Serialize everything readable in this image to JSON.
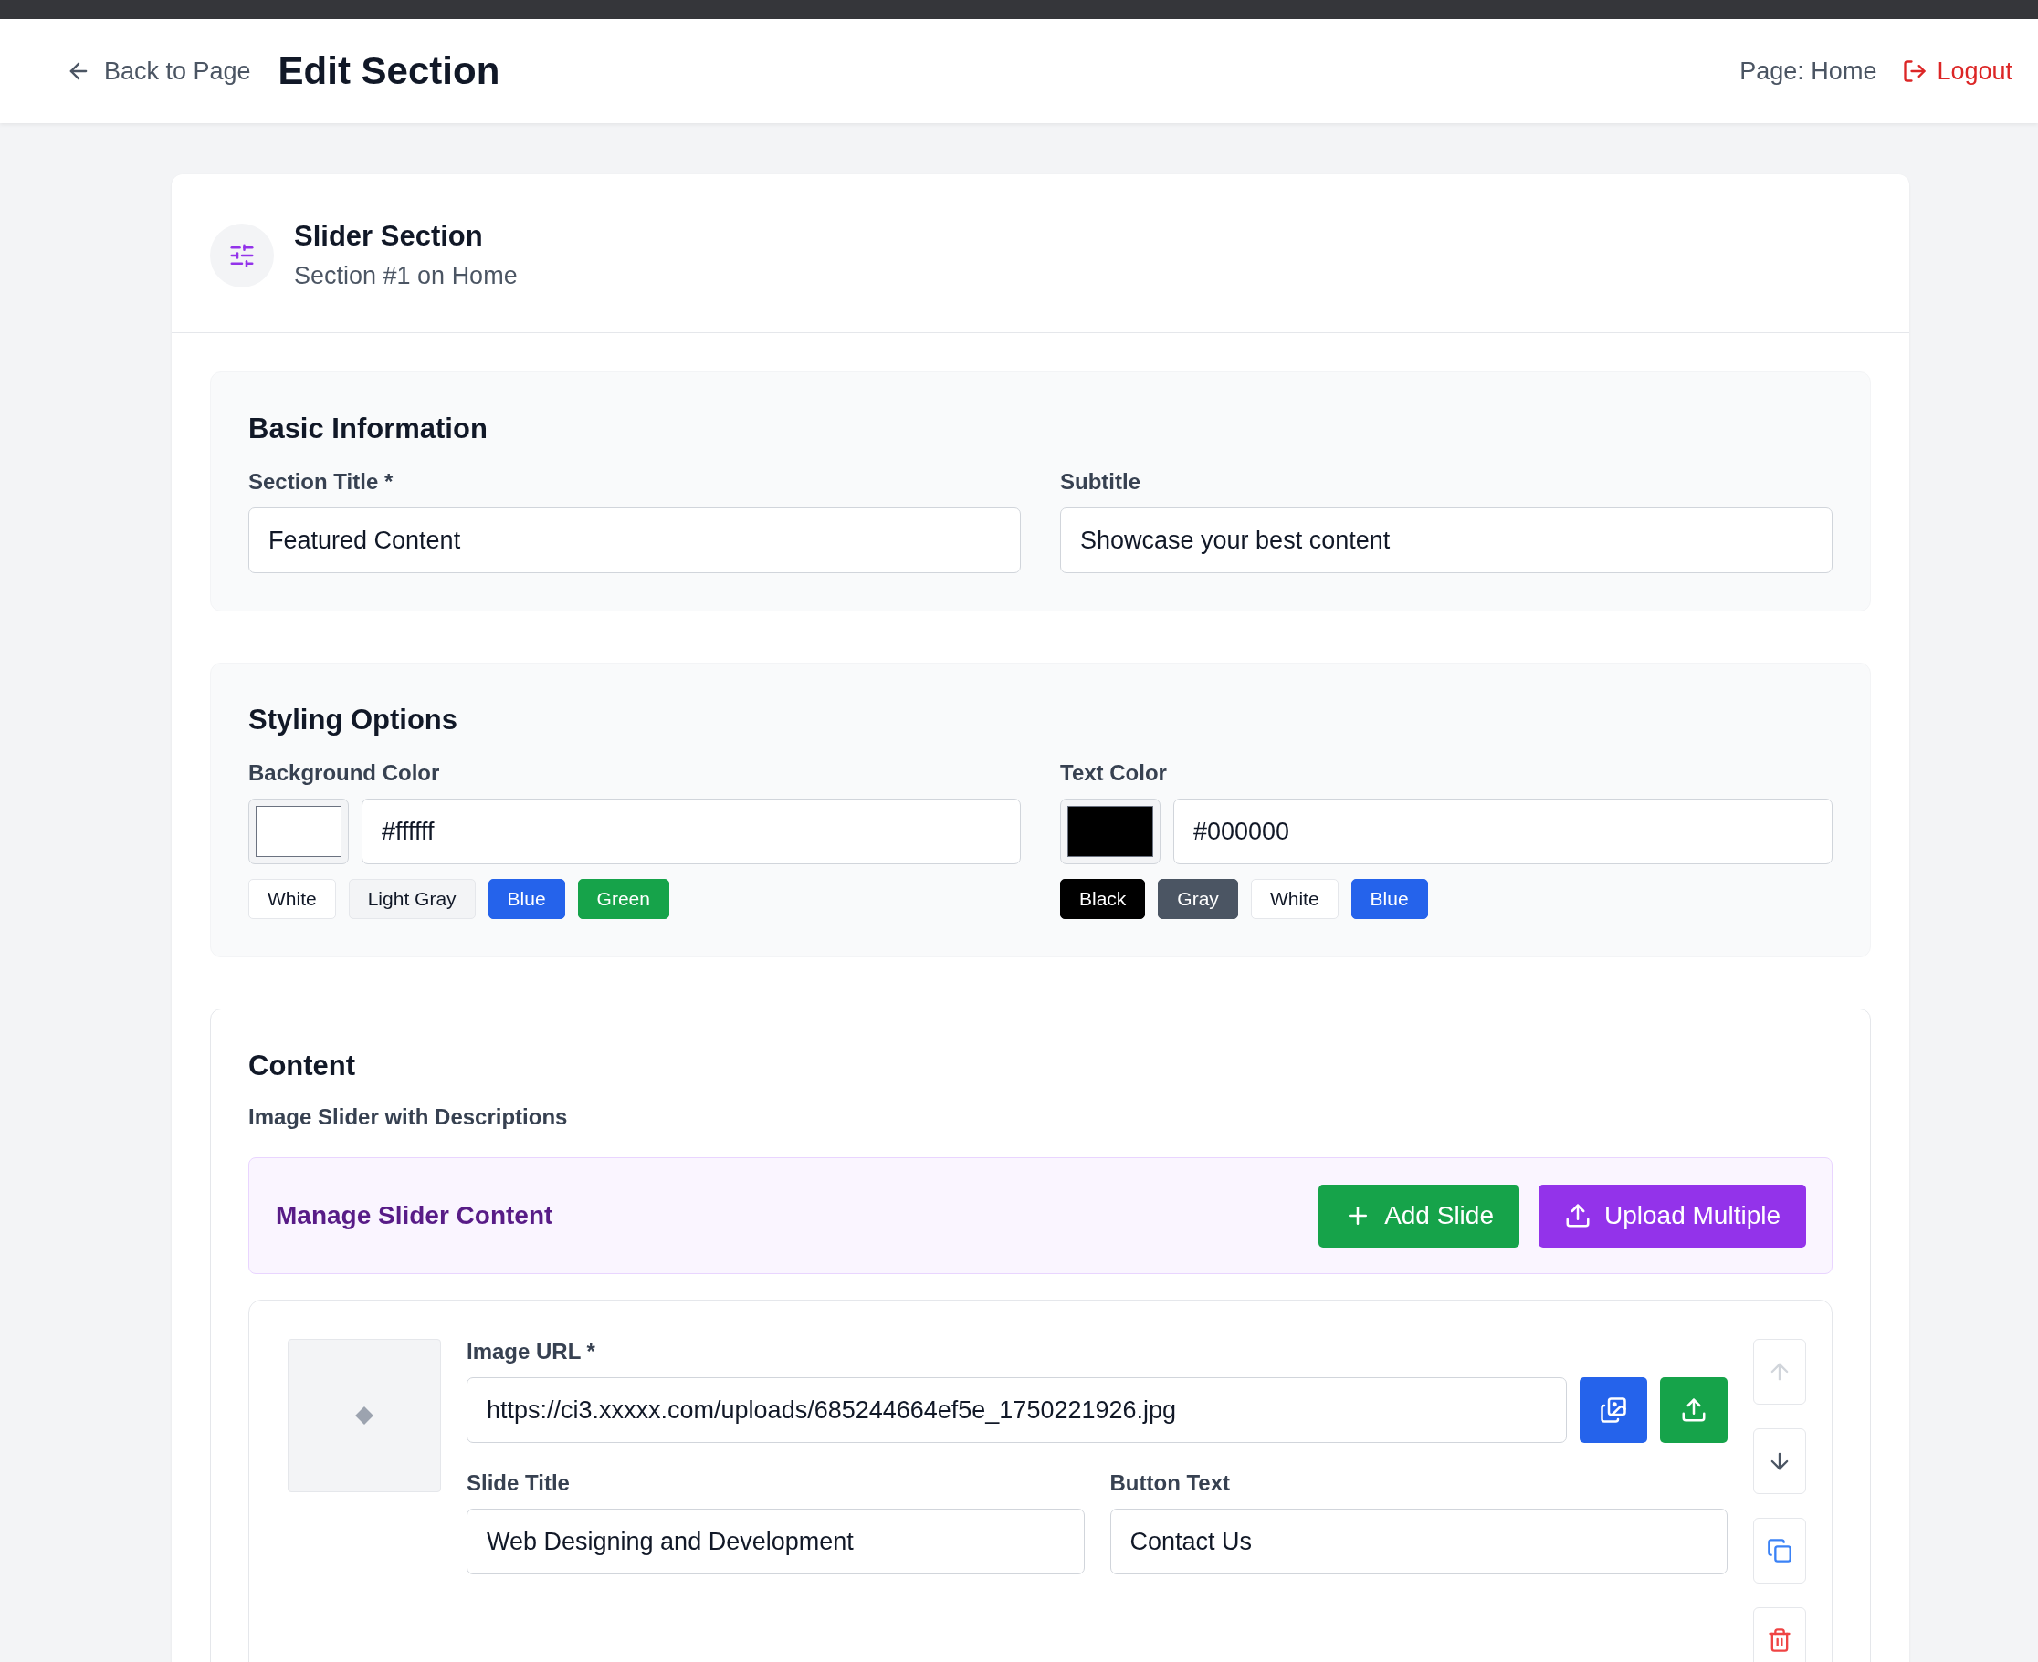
{
  "header": {
    "back_link": "Back to Page",
    "title": "Edit Section",
    "page_label": "Page: Home",
    "logout": "Logout"
  },
  "section": {
    "title": "Slider Section",
    "subtitle": "Section #1 on Home"
  },
  "basic_info": {
    "heading": "Basic Information",
    "fields": [
      {
        "label": "Section Title *",
        "value": "Featured Content"
      },
      {
        "label": "Subtitle",
        "value": "Showcase your best content"
      }
    ]
  },
  "styling": {
    "heading": "Styling Options",
    "colors": [
      {
        "label": "Background Color",
        "value": "#ffffff",
        "presets": [
          {
            "label": "White",
            "color": "#ffffff"
          },
          {
            "label": "Light Gray",
            "color": "#f3f4f6"
          },
          {
            "label": "Blue",
            "color": "#2563eb"
          },
          {
            "label": "Green",
            "color": "#16a34a"
          }
        ]
      },
      {
        "label": "Text Color",
        "value": "#000000",
        "presets": [
          {
            "label": "Black",
            "color": "#000000"
          },
          {
            "label": "Gray",
            "color": "#4b5563"
          },
          {
            "label": "White",
            "color": "#ffffff"
          },
          {
            "label": "Blue",
            "color": "#2563eb"
          }
        ]
      }
    ]
  },
  "content": {
    "heading": "Content",
    "description": "Image Slider with Descriptions",
    "manager": {
      "title": "Manage Slider Content",
      "buttons": [
        {
          "label": "Add Slide",
          "kind": "add"
        },
        {
          "label": "Upload Multiple",
          "kind": "upload"
        }
      ]
    },
    "slides": [
      {
        "image_label": "Image URL *",
        "image_url": "https://ci3.xxxxx.com/uploads/685244664ef5e_1750221926.jpg",
        "title_label": "Slide Title",
        "title": "Web Designing and Development",
        "button_label": "Button Text",
        "button_text": "Contact Us",
        "actions": [
          {
            "kind": "up",
            "disabled": true
          },
          {
            "kind": "down",
            "disabled": false
          },
          {
            "kind": "copy",
            "disabled": false
          },
          {
            "kind": "delete",
            "disabled": false
          }
        ]
      }
    ]
  }
}
